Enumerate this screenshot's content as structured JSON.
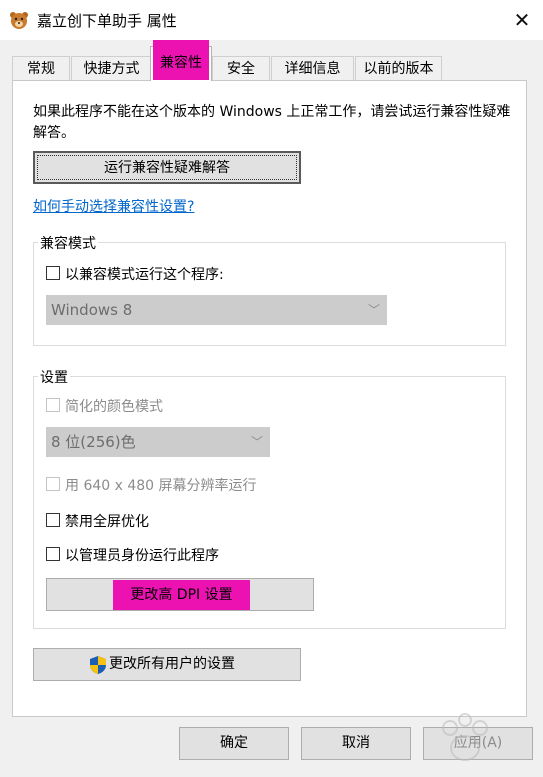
{
  "window": {
    "title": "嘉立创下单助手 属性",
    "icon": "bear-app-icon",
    "close_label": "✕"
  },
  "tabs": [
    {
      "label": "常规"
    },
    {
      "label": "快捷方式"
    },
    {
      "label": "兼容性",
      "active": true
    },
    {
      "label": "安全"
    },
    {
      "label": "详细信息"
    },
    {
      "label": "以前的版本"
    }
  ],
  "compat": {
    "description": "如果此程序不能在这个版本的 Windows 上正常工作，请尝试运行兼容性疑难解答。",
    "troubleshoot_button": "运行兼容性疑难解答",
    "manual_link": "如何手动选择兼容性设置?"
  },
  "compat_mode": {
    "group_label": "兼容模式",
    "checkbox_label": "以兼容模式运行这个程序:",
    "checked": false,
    "os_select_value": "Windows 8"
  },
  "settings": {
    "group_label": "设置",
    "reduced_color_label": "简化的颜色模式",
    "color_depth_value": "8 位(256)色",
    "res_640_label": "用 640 x 480 屏幕分辨率运行",
    "disable_fullscreen_label": "禁用全屏优化",
    "run_as_admin_label": "以管理员身份运行此程序",
    "dpi_button": "更改高 DPI 设置"
  },
  "all_users_button": "更改所有用户的设置",
  "footer": {
    "ok": "确定",
    "cancel": "取消",
    "apply": "应用(A)"
  },
  "colors": {
    "highlight": "#ec12b2",
    "link": "#0066cc"
  }
}
